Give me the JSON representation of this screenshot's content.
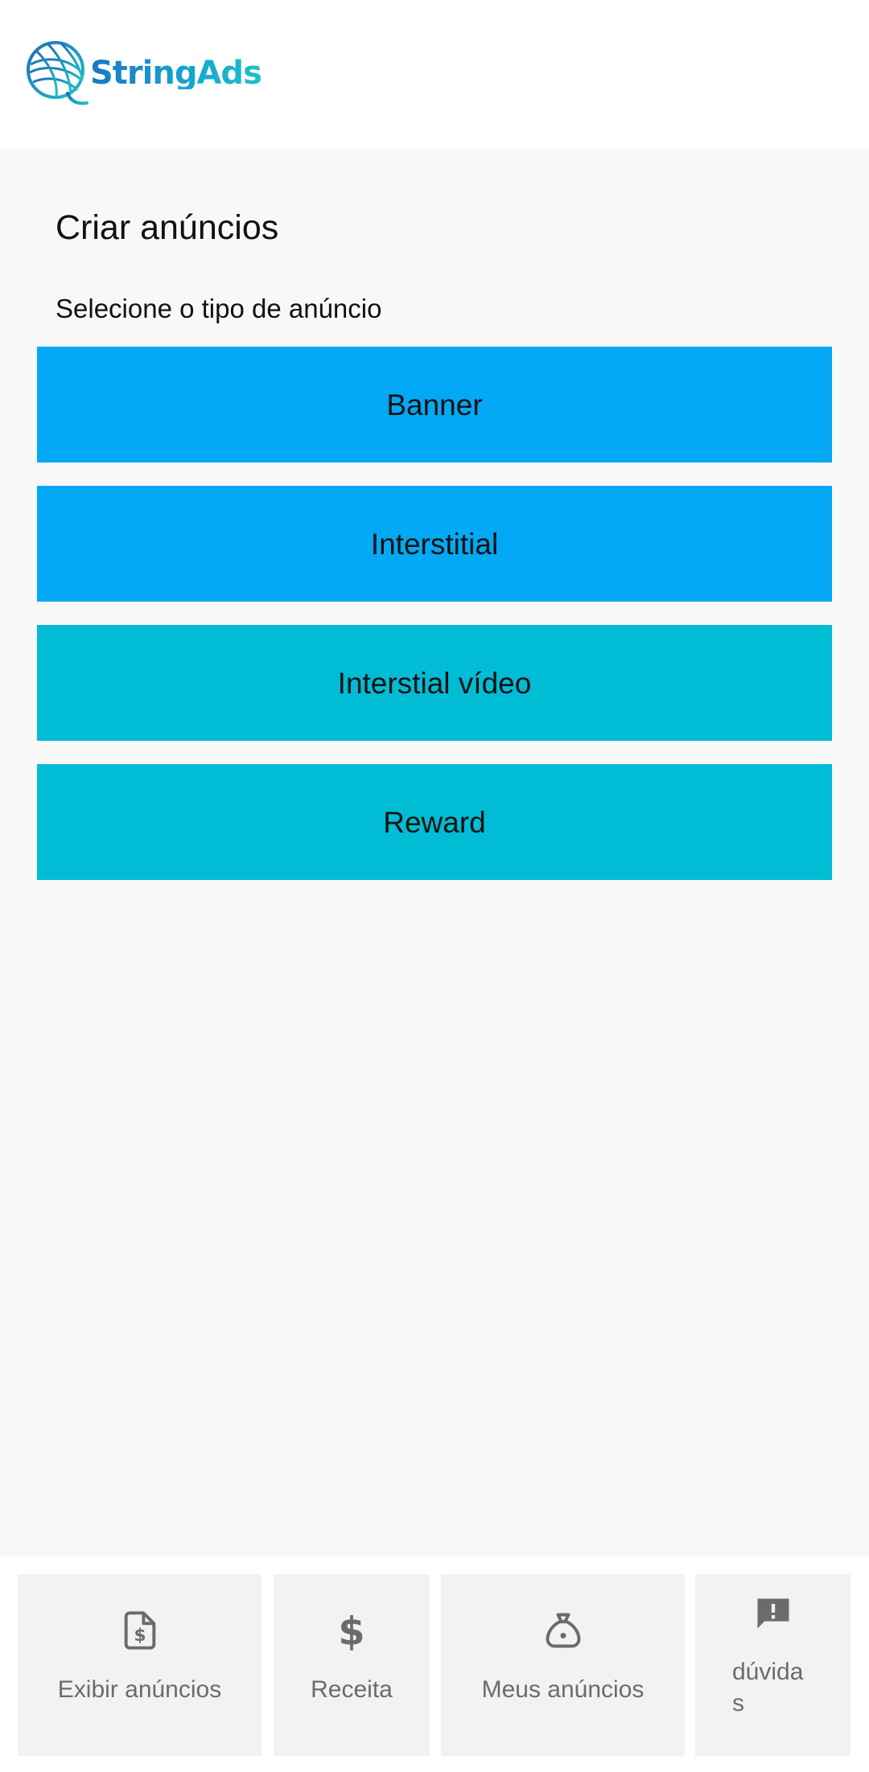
{
  "brand": {
    "name": "StringAds"
  },
  "main": {
    "title": "Criar anúncios",
    "subtitle": "Selecione o tipo de anúncio",
    "ad_types": [
      {
        "label": "Banner",
        "color": "#03a9f4"
      },
      {
        "label": "Interstitial",
        "color": "#03a9f4"
      },
      {
        "label": "Interstial vídeo",
        "color": "#00bcd4"
      },
      {
        "label": "Reward",
        "color": "#00bcd4"
      }
    ]
  },
  "bottom_nav": {
    "items": [
      {
        "label": "Exibir anúncios",
        "icon": "document-dollar-icon"
      },
      {
        "label": "Receita",
        "icon": "dollar-icon"
      },
      {
        "label": "Meus anúncios",
        "icon": "money-bag-icon"
      },
      {
        "label_line1": "dúvida",
        "label_line2": "s",
        "icon": "feedback-alert-icon"
      }
    ]
  },
  "colors": {
    "primary_light_blue": "#03a9f4",
    "primary_cyan": "#00bcd4",
    "nav_background": "#f2f2f2",
    "nav_text": "#6b6b6b"
  }
}
